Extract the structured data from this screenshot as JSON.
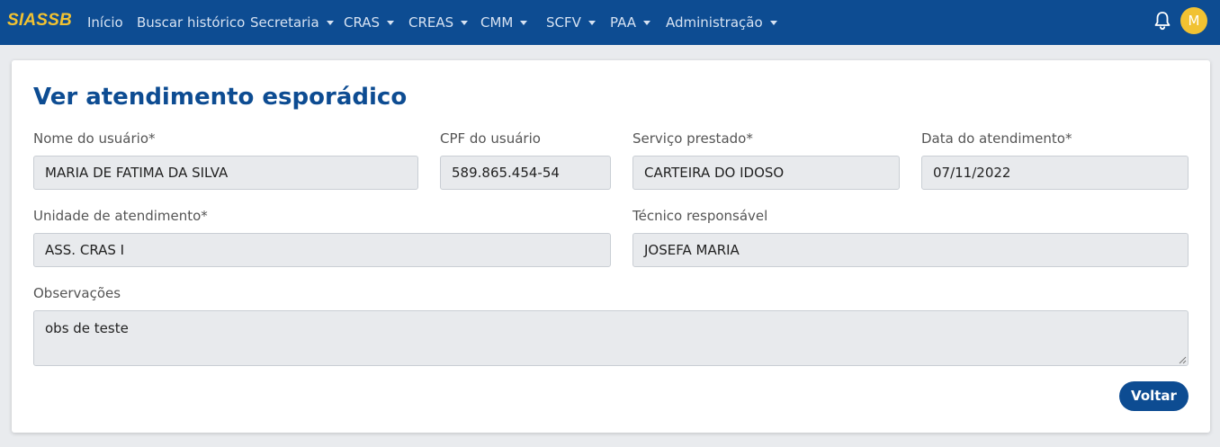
{
  "brand": "SIASSB",
  "nav": {
    "items": [
      {
        "label": "Início",
        "dropdown": false
      },
      {
        "label": "Buscar histórico",
        "dropdown": false
      },
      {
        "label": "Secretaria",
        "dropdown": true
      },
      {
        "label": "CRAS",
        "dropdown": true
      },
      {
        "label": "CREAS",
        "dropdown": true
      },
      {
        "label": "CMM",
        "dropdown": true
      },
      {
        "label": "SCFV",
        "dropdown": true
      },
      {
        "label": "PAA",
        "dropdown": true
      },
      {
        "label": "Administração",
        "dropdown": true
      }
    ],
    "notification_icon": "bell-icon",
    "avatar_initial": "M"
  },
  "colors": {
    "navbar": "#0d4c92",
    "brand": "#f1c232",
    "accent": "#0d4c92"
  },
  "page": {
    "title": "Ver atendimento esporádico",
    "fields": {
      "nome": {
        "label": "Nome do usuário*",
        "value": "MARIA DE FATIMA DA SILVA"
      },
      "cpf": {
        "label": "CPF do usuário",
        "value": "589.865.454-54"
      },
      "servico": {
        "label": "Serviço prestado*",
        "value": "CARTEIRA DO IDOSO"
      },
      "data": {
        "label": "Data do atendimento*",
        "value": "07/11/2022"
      },
      "unidade": {
        "label": "Unidade de atendimento*",
        "value": "ASS. CRAS I"
      },
      "tecnico": {
        "label": "Técnico responsável",
        "value": "JOSEFA MARIA"
      },
      "observacoes": {
        "label": "Observações",
        "value": "obs de teste"
      }
    },
    "back_button": "Voltar"
  }
}
